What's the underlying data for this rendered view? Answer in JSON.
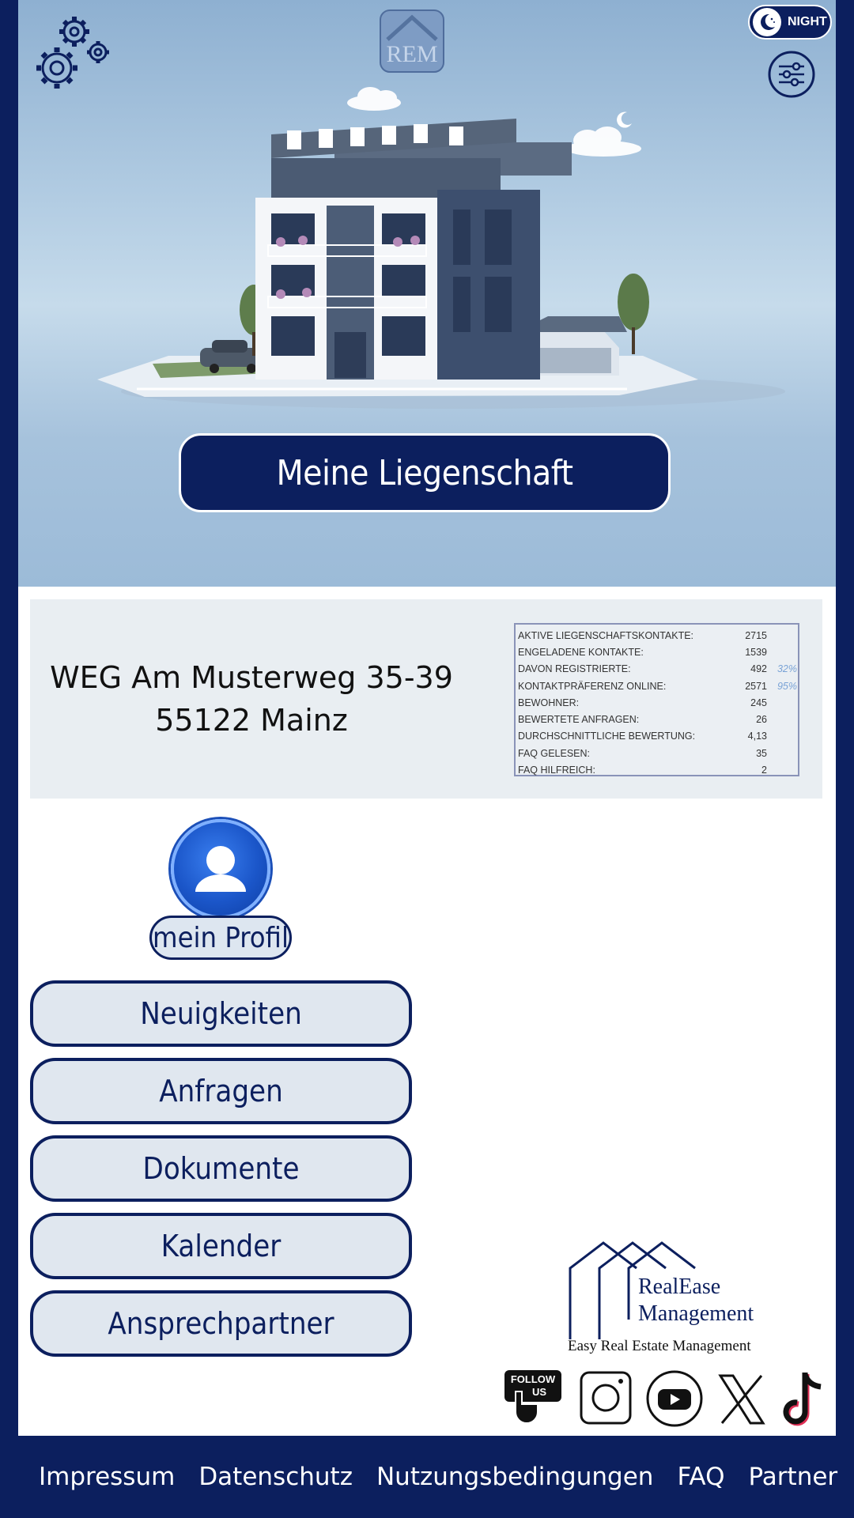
{
  "header": {
    "logo_text": "REM",
    "night_label": "NIGHT"
  },
  "hero": {
    "button_label": "Meine Liegenschaft"
  },
  "property": {
    "address_line1": "WEG Am Musterweg 35-39",
    "address_line2": "55122 Mainz"
  },
  "stats": [
    {
      "label": "AKTIVE LIEGENSCHAFTSKONTAKTE:",
      "value": "2715",
      "pct": ""
    },
    {
      "label": "ENGELADENE KONTAKTE:",
      "value": "1539",
      "pct": ""
    },
    {
      "label": "DAVON REGISTRIERTE:",
      "value": "492",
      "pct": "32%"
    },
    {
      "label": "KONTAKTPRÄFERENZ ONLINE:",
      "value": "2571",
      "pct": "95%"
    },
    {
      "label": "BEWOHNER:",
      "value": "245",
      "pct": ""
    },
    {
      "label": "BEWERTETE ANFRAGEN:",
      "value": "26",
      "pct": ""
    },
    {
      "label": "DURCHSCHNITTLICHE BEWERTUNG:",
      "value": "4,13",
      "pct": ""
    },
    {
      "label": "FAQ GELESEN:",
      "value": "35",
      "pct": ""
    },
    {
      "label": "FAQ HILFREICH:",
      "value": "2",
      "pct": ""
    }
  ],
  "profile": {
    "label": "mein Profil"
  },
  "menu": [
    {
      "label": "Neuigkeiten"
    },
    {
      "label": "Anfragen"
    },
    {
      "label": "Dokumente"
    },
    {
      "label": "Kalender"
    },
    {
      "label": "Ansprechpartner"
    }
  ],
  "company": {
    "name_line1": "RealEase",
    "name_line2": "Management",
    "tagline": "Easy Real Estate Management"
  },
  "social": {
    "follow_line1": "FOLLOW",
    "follow_line2": "US",
    "icons": [
      "follow-us-icon",
      "instagram-icon",
      "youtube-icon",
      "x-icon",
      "tiktok-icon"
    ]
  },
  "footer": {
    "links": [
      "Impressum",
      "Datenschutz",
      "Nutzungsbedingungen",
      "FAQ",
      "Partner"
    ]
  },
  "colors": {
    "navy": "#0c1f5e",
    "button_fill": "#e0e7ef",
    "info_bg": "#e9eef2",
    "accent_pct": "#7aa3d6"
  }
}
